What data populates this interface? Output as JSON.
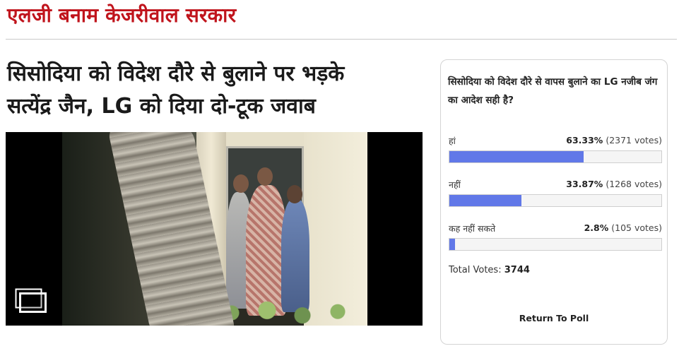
{
  "section": {
    "title": "एलजी बनाम केजरीवाल सरकार"
  },
  "article": {
    "headline_line1": "सिसोदिया को विदेश दौरे से बुलाने पर भड़के",
    "headline_line2": "सत्येंद्र जैन, LG को दिया दो-टूक जवाब",
    "media_icon": "gallery-icon"
  },
  "poll": {
    "question": "सिसोदिया को विदेश दौरे से वापस बुलाने का LG नजीब जंग का आदेश सही है?",
    "options": [
      {
        "label": "हां",
        "percent": "63.33%",
        "votes": "(2371 votes)",
        "fraction": 0.6333
      },
      {
        "label": "नहीं",
        "percent": "33.87%",
        "votes": "(1268 votes)",
        "fraction": 0.3387
      },
      {
        "label": "कह नहीं सकते",
        "percent": "2.8%",
        "votes": "(105 votes)",
        "fraction": 0.028
      }
    ],
    "total_label": "Total Votes:",
    "total_value": "3744",
    "return_label": "Return To Poll",
    "bar_color": "#6178e8"
  },
  "colors": {
    "accent": "#c0141c"
  }
}
